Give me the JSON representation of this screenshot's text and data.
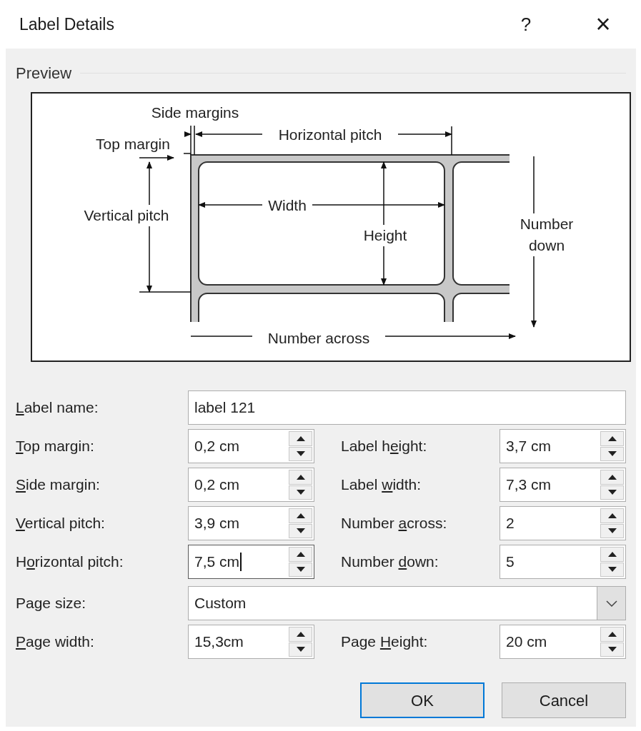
{
  "window": {
    "title": "Label Details",
    "help_button": "?",
    "close_button": "×"
  },
  "preview": {
    "title": "Preview",
    "labels": [
      "Side margins",
      "Top margin",
      "Horizontal pitch",
      "Vertical pitch",
      "Width",
      "Height",
      "Number down",
      "Number across"
    ]
  },
  "rows": [
    {
      "fields": [
        {
          "kind": "text",
          "label": {
            "key": "L",
            "after": "abel name:"
          },
          "value": "label 121",
          "focused": false
        }
      ]
    },
    {
      "fields": [
        {
          "kind": "spin",
          "label": {
            "key": "T",
            "after": "op margin:"
          },
          "value": "0,2 cm",
          "focused": false
        },
        {
          "kind": "spin",
          "label": {
            "before": "Label h",
            "key": "e",
            "after": "ight:"
          },
          "value": "3,7 cm",
          "focused": false
        }
      ]
    },
    {
      "fields": [
        {
          "kind": "spin",
          "label": {
            "key": "S",
            "after": "ide margin:"
          },
          "value": "0,2 cm",
          "focused": false
        },
        {
          "kind": "spin",
          "label": {
            "before": "Label ",
            "key": "w",
            "after": "idth:"
          },
          "value": "7,3 cm",
          "focused": false
        }
      ]
    },
    {
      "fields": [
        {
          "kind": "spin",
          "label": {
            "key": "V",
            "after": "ertical pitch:"
          },
          "value": "3,9 cm",
          "focused": false
        },
        {
          "kind": "spin",
          "label": {
            "before": "Number ",
            "key": "a",
            "after": "cross:"
          },
          "value": "2",
          "focused": false
        }
      ]
    },
    {
      "fields": [
        {
          "kind": "spin",
          "label": {
            "before": "H",
            "key": "o",
            "after": "rizontal pitch:"
          },
          "value": "7,5 cm",
          "focused": true
        },
        {
          "kind": "spin",
          "label": {
            "before": "Number ",
            "key": "d",
            "after": "own:"
          },
          "value": "5",
          "focused": false
        }
      ]
    },
    {
      "fields": [
        {
          "kind": "select",
          "label": {
            "before": "Page size:"
          },
          "value": "Custom",
          "focused": false
        }
      ]
    },
    {
      "fields": [
        {
          "kind": "spin",
          "label": {
            "key": "P",
            "after": "age width:"
          },
          "value": "15,3cm",
          "focused": false
        },
        {
          "kind": "spin",
          "label": {
            "before": "Page ",
            "key": "H",
            "after": "eight:"
          },
          "value": "20 cm",
          "focused": false
        }
      ]
    }
  ],
  "buttons": [
    {
      "label": "OK",
      "default": true
    },
    {
      "label": "Cancel",
      "default": false
    }
  ]
}
